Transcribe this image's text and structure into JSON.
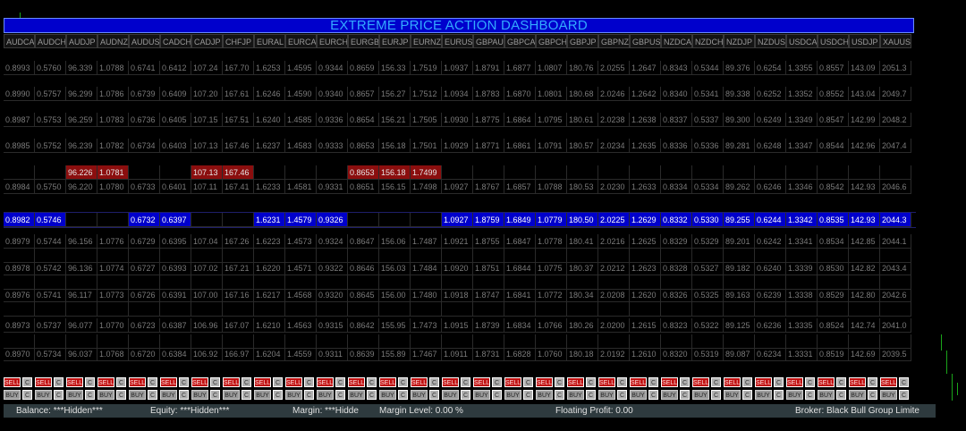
{
  "title": "EXTREME PRICE ACTION DASHBOARD",
  "symbols": [
    "AUDCA",
    "AUDCH",
    "AUDJP",
    "AUDNZ",
    "AUDUS",
    "CADCH",
    "CADJP",
    "CHFJP",
    "EURAL",
    "EURCA",
    "EURCH",
    "EURGB",
    "EURJP",
    "EURNZ",
    "EURUS",
    "GBPAU",
    "GBPCA",
    "GBPCH",
    "GBPJP",
    "GBPNZ",
    "GBPUS",
    "NZDCA",
    "NZDCH",
    "NZDJP",
    "NZDUS",
    "USDCA",
    "USDCH",
    "USDJP",
    "XAUUS"
  ],
  "rows": [
    [
      "0.8993",
      "0.5760",
      "96.339",
      "1.0788",
      "0.6741",
      "0.6412",
      "107.24",
      "167.70",
      "1.6253",
      "1.4595",
      "0.9344",
      "0.8659",
      "156.33",
      "1.7519",
      "1.0937",
      "1.8791",
      "1.6877",
      "1.0807",
      "180.76",
      "2.0255",
      "1.2647",
      "0.8343",
      "0.5344",
      "89.376",
      "0.6254",
      "1.3355",
      "0.8557",
      "143.09",
      "2051.3"
    ],
    [
      "0.8990",
      "0.5757",
      "96.299",
      "1.0786",
      "0.6739",
      "0.6409",
      "107.20",
      "167.61",
      "1.6246",
      "1.4590",
      "0.9340",
      "0.8657",
      "156.27",
      "1.7512",
      "1.0934",
      "1.8783",
      "1.6870",
      "1.0801",
      "180.68",
      "2.0246",
      "1.2642",
      "0.8340",
      "0.5341",
      "89.338",
      "0.6252",
      "1.3352",
      "0.8552",
      "143.04",
      "2049.7"
    ],
    [
      "0.8987",
      "0.5753",
      "96.259",
      "1.0783",
      "0.6736",
      "0.6405",
      "107.15",
      "167.51",
      "1.6240",
      "1.4585",
      "0.9336",
      "0.8654",
      "156.21",
      "1.7505",
      "1.0930",
      "1.8775",
      "1.6864",
      "1.0795",
      "180.61",
      "2.0238",
      "1.2638",
      "0.8337",
      "0.5337",
      "89.300",
      "0.6249",
      "1.3349",
      "0.8547",
      "142.99",
      "2048.2"
    ],
    [
      "0.8985",
      "0.5752",
      "96.239",
      "1.0782",
      "0.6734",
      "0.6403",
      "107.13",
      "167.46",
      "1.6237",
      "1.4583",
      "0.9333",
      "0.8653",
      "156.18",
      "1.7501",
      "1.0929",
      "1.8771",
      "1.6861",
      "1.0791",
      "180.57",
      "2.0234",
      "1.2635",
      "0.8336",
      "0.5336",
      "89.281",
      "0.6248",
      "1.3347",
      "0.8544",
      "142.96",
      "2047.4"
    ],
    [
      "",
      "",
      "96.226",
      "1.0781",
      "",
      "",
      "107.13",
      "167.46",
      "",
      "",
      "",
      "0.8653",
      "156.18",
      "1.7499",
      "",
      "",
      "",
      "",
      "",
      "",
      "",
      "",
      "",
      "",
      "",
      "",
      "",
      "",
      ""
    ],
    [
      "0.8984",
      "0.5750",
      "96.220",
      "1.0780",
      "0.6733",
      "0.6401",
      "107.11",
      "167.41",
      "1.6233",
      "1.4581",
      "0.9331",
      "0.8651",
      "156.15",
      "1.7498",
      "1.0927",
      "1.8767",
      "1.6857",
      "1.0788",
      "180.53",
      "2.0230",
      "1.2633",
      "0.8334",
      "0.5334",
      "89.262",
      "0.6246",
      "1.3346",
      "0.8542",
      "142.93",
      "2046.6"
    ],
    [
      "0.8982",
      "0.5746",
      "",
      "",
      "0.6732",
      "0.6397",
      "",
      "",
      "1.6231",
      "1.4579",
      "0.9326",
      "",
      "",
      "",
      "1.0927",
      "1.8759",
      "1.6849",
      "1.0779",
      "180.50",
      "2.0225",
      "1.2629",
      "0.8332",
      "0.5330",
      "89.255",
      "0.6244",
      "1.3342",
      "0.8535",
      "142.93",
      "2044.3"
    ],
    [
      "0.8979",
      "0.5744",
      "96.156",
      "1.0776",
      "0.6729",
      "0.6395",
      "107.04",
      "167.26",
      "1.6223",
      "1.4573",
      "0.9324",
      "0.8647",
      "156.06",
      "1.7487",
      "1.0921",
      "1.8755",
      "1.6847",
      "1.0778",
      "180.41",
      "2.0216",
      "1.2625",
      "0.8329",
      "0.5329",
      "89.201",
      "0.6242",
      "1.3341",
      "0.8534",
      "142.85",
      "2044.1"
    ],
    [
      "",
      "",
      "",
      "",
      "",
      "",
      "",
      "",
      "",
      "",
      "",
      "",
      "",
      "",
      "",
      "",
      "",
      "",
      "",
      "",
      "",
      "",
      "",
      "",
      "",
      "",
      "",
      "",
      ""
    ],
    [
      "0.8978",
      "0.5742",
      "96.136",
      "1.0774",
      "0.6727",
      "0.6393",
      "107.02",
      "167.21",
      "1.6220",
      "1.4571",
      "0.9322",
      "0.8646",
      "156.03",
      "1.7484",
      "1.0920",
      "1.8751",
      "1.6844",
      "1.0775",
      "180.37",
      "2.0212",
      "1.2623",
      "0.8328",
      "0.5327",
      "89.182",
      "0.6240",
      "1.3339",
      "0.8530",
      "142.82",
      "2043.4"
    ],
    [
      "",
      "",
      "",
      "",
      "",
      "",
      "",
      "",
      "",
      "",
      "",
      "",
      "",
      "",
      "",
      "",
      "",
      "",
      "",
      "",
      "",
      "",
      "",
      "",
      "",
      "",
      "",
      "",
      ""
    ],
    [
      "0.8976",
      "0.5741",
      "96.117",
      "1.0773",
      "0.6726",
      "0.6391",
      "107.00",
      "167.16",
      "1.6217",
      "1.4568",
      "0.9320",
      "0.8645",
      "156.00",
      "1.7480",
      "1.0918",
      "1.8747",
      "1.6841",
      "1.0772",
      "180.34",
      "2.0208",
      "1.2620",
      "0.8326",
      "0.5325",
      "89.163",
      "0.6239",
      "1.3338",
      "0.8529",
      "142.80",
      "2042.6"
    ],
    [
      "",
      "",
      "",
      "",
      "",
      "",
      "",
      "",
      "",
      "",
      "",
      "",
      "",
      "",
      "",
      "",
      "",
      "",
      "",
      "",
      "",
      "",
      "",
      "",
      "",
      "",
      "",
      "",
      ""
    ],
    [
      "0.8973",
      "0.5737",
      "96.077",
      "1.0770",
      "0.6723",
      "0.6387",
      "106.96",
      "167.07",
      "1.6210",
      "1.4563",
      "0.9315",
      "0.8642",
      "155.95",
      "1.7473",
      "1.0915",
      "1.8739",
      "1.6834",
      "1.0766",
      "180.26",
      "2.0200",
      "1.2615",
      "0.8323",
      "0.5322",
      "89.125",
      "0.6236",
      "1.3335",
      "0.8524",
      "142.74",
      "2041.0"
    ],
    [
      "",
      "",
      "",
      "",
      "",
      "",
      "",
      "",
      "",
      "",
      "",
      "",
      "",
      "",
      "",
      "",
      "",
      "",
      "",
      "",
      "",
      "",
      "",
      "",
      "",
      "",
      "",
      "",
      ""
    ],
    [
      "0.8970",
      "0.5734",
      "96.037",
      "1.0768",
      "0.6720",
      "0.6384",
      "106.92",
      "166.97",
      "1.6204",
      "1.4559",
      "0.9311",
      "0.8639",
      "155.89",
      "1.7467",
      "1.0911",
      "1.8731",
      "1.6828",
      "1.0760",
      "180.18",
      "2.0192",
      "1.2610",
      "0.8320",
      "0.5319",
      "89.087",
      "0.6234",
      "1.3331",
      "0.8519",
      "142.69",
      "2039.5"
    ]
  ],
  "highlights": {
    "red": [
      [
        4,
        2
      ],
      [
        4,
        3
      ],
      [
        4,
        6
      ],
      [
        4,
        7
      ],
      [
        4,
        11
      ],
      [
        4,
        12
      ],
      [
        4,
        13
      ]
    ],
    "blue": [
      [
        6,
        0
      ],
      [
        6,
        1
      ],
      [
        6,
        4
      ],
      [
        6,
        5
      ],
      [
        6,
        8
      ],
      [
        6,
        9
      ],
      [
        6,
        10
      ],
      [
        6,
        14
      ],
      [
        6,
        15
      ],
      [
        6,
        16
      ],
      [
        6,
        17
      ],
      [
        6,
        18
      ],
      [
        6,
        19
      ],
      [
        6,
        20
      ],
      [
        6,
        21
      ],
      [
        6,
        22
      ],
      [
        6,
        23
      ],
      [
        6,
        24
      ],
      [
        6,
        25
      ],
      [
        6,
        26
      ],
      [
        6,
        27
      ],
      [
        6,
        28
      ]
    ]
  },
  "buttons": {
    "sell": "SELL",
    "buy": "BUY",
    "close": "C"
  },
  "status": {
    "balance": "Balance: ***Hidden***",
    "equity": "Equity: ***Hidden***",
    "margin": "Margin: ***Hidde",
    "margin_level": "Margin Level: 0.00 %",
    "floating": "Floating Profit: 0.00",
    "broker": "Broker: Black Bull Group Limite"
  },
  "colors": {
    "title_bg": "#0000cc",
    "title_text": "#33aaff",
    "red": "#8b0e0e",
    "blue": "#0000cc",
    "status_bg": "#2e3a3e"
  }
}
